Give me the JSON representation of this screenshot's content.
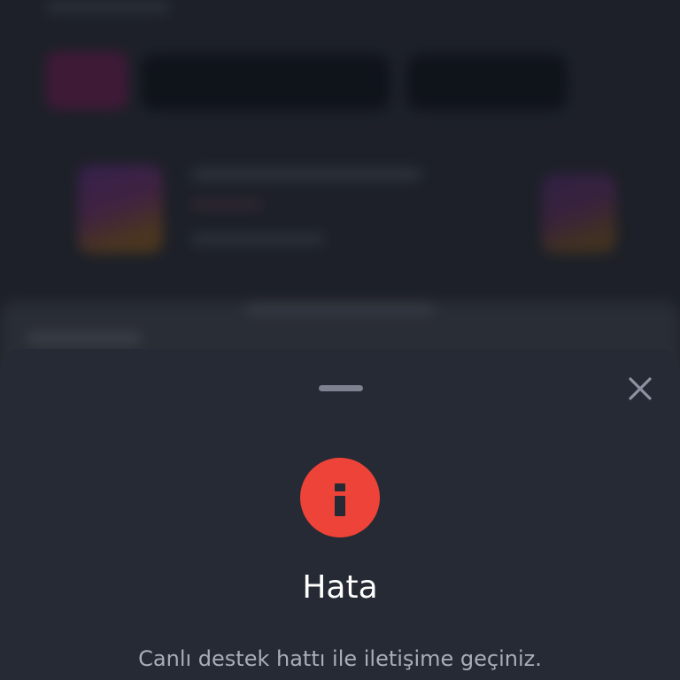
{
  "modal": {
    "title": "Hata",
    "message": "Canlı destek hattı ile iletişime geçiniz.",
    "icon": "info-icon",
    "close_icon": "close-icon",
    "icon_color": "#ee4338"
  },
  "background": {
    "blurred": true
  },
  "colors": {
    "sheet": "#262a34",
    "accent_error": "#ee4338",
    "title_text": "#ffffff",
    "message_text": "#a9adb8"
  }
}
